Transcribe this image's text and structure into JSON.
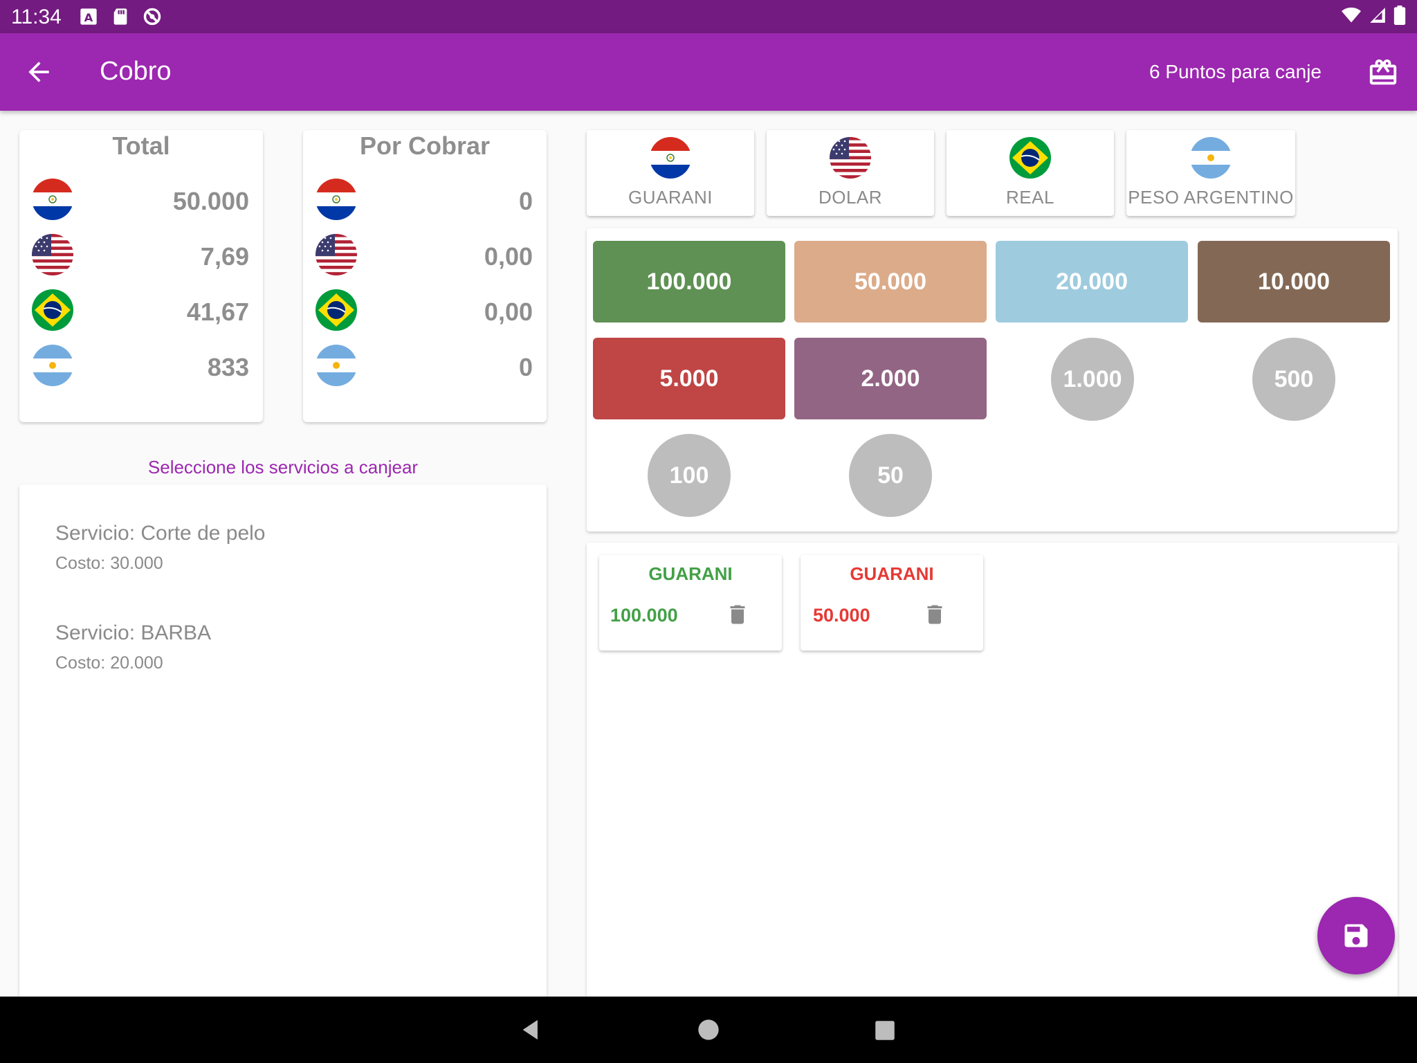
{
  "status_bar": {
    "time": "11:34"
  },
  "app_bar": {
    "title": "Cobro",
    "points_text": "6 Puntos para canje"
  },
  "summary_cards": [
    {
      "heading": "Total",
      "values": [
        "50.000",
        "7,69",
        "41,67",
        "833"
      ]
    },
    {
      "heading": "Por Cobrar",
      "values": [
        "0",
        "0,00",
        "0,00",
        "0"
      ]
    }
  ],
  "instruction": "Seleccione los servicios a canjear",
  "services": [
    {
      "title": "Servicio: Corte de pelo",
      "cost": "Costo: 30.000"
    },
    {
      "title": "Servicio: BARBA",
      "cost": "Costo: 20.000"
    }
  ],
  "currencies": [
    {
      "label": "GUARANI",
      "flag": "paraguay-flag"
    },
    {
      "label": "DOLAR",
      "flag": "usa-flag"
    },
    {
      "label": "REAL",
      "flag": "brazil-flag"
    },
    {
      "label": "PESO ARGENTINO",
      "flag": "argentina-flag"
    }
  ],
  "notes": [
    {
      "label": "100.000",
      "color": "#5e9153"
    },
    {
      "label": "50.000",
      "color": "#dbab8a"
    },
    {
      "label": "20.000",
      "color": "#9ecbde"
    },
    {
      "label": "10.000",
      "color": "#836955"
    },
    {
      "label": "5.000",
      "color": "#c04545"
    },
    {
      "label": "2.000",
      "color": "#936584"
    }
  ],
  "coins": [
    {
      "label": "1.000"
    },
    {
      "label": "500"
    },
    {
      "label": "100"
    },
    {
      "label": "50"
    }
  ],
  "payments": [
    {
      "currency": "GUARANI",
      "amount": "100.000",
      "color": "#43a047"
    },
    {
      "currency": "GUARANI",
      "amount": "50.000",
      "color": "#e53935"
    }
  ],
  "colors": {
    "primary": "#9c27b0",
    "primary_dark": "#731b80"
  }
}
